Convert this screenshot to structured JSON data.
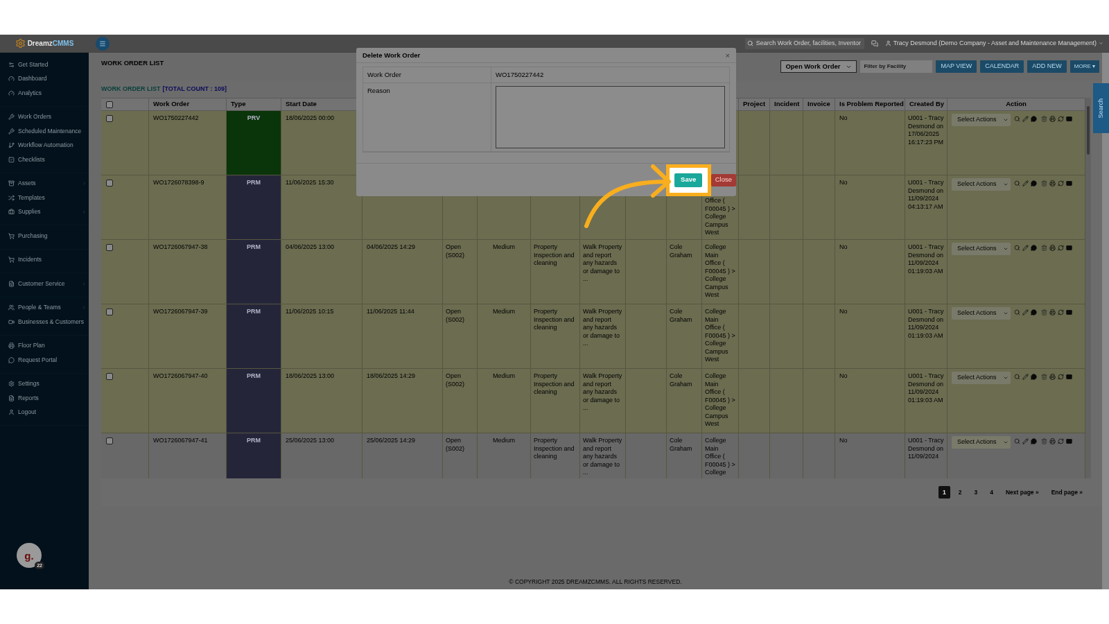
{
  "logo": {
    "name": "Dreamz",
    "suffix": "CMMS"
  },
  "top_bar": {
    "search": {
      "placeholder": "Search Work Order, facilities, Inventor"
    },
    "user": "Tracy Desmond (Demo Company - Asset and Maintenance Management)"
  },
  "sidebar": {
    "groups": [
      [
        {
          "label": "Get Started",
          "has_submenu": false
        },
        {
          "label": "Dashboard",
          "has_submenu": false
        },
        {
          "label": "Analytics",
          "has_submenu": false
        }
      ],
      [
        {
          "label": "Work Orders",
          "has_submenu": false
        },
        {
          "label": "Scheduled Maintenance",
          "has_submenu": false
        },
        {
          "label": "Workflow Automation",
          "has_submenu": false
        },
        {
          "label": "Checklists",
          "has_submenu": false
        }
      ],
      [
        {
          "label": "Assets",
          "has_submenu": true
        },
        {
          "label": "Templates",
          "has_submenu": false
        },
        {
          "label": "Supplies",
          "has_submenu": true
        }
      ],
      [
        {
          "label": "Purchasing",
          "has_submenu": false
        }
      ],
      [
        {
          "label": "Incidents",
          "has_submenu": false
        }
      ],
      [
        {
          "label": "Customer Service",
          "has_submenu": true
        }
      ],
      [
        {
          "label": "People & Teams",
          "has_submenu": true
        },
        {
          "label": "Businesses & Customers",
          "has_submenu": false
        }
      ],
      [
        {
          "label": "Floor Plan",
          "has_submenu": false
        },
        {
          "label": "Request Portal",
          "has_submenu": false
        }
      ],
      [
        {
          "label": "Settings",
          "has_submenu": false
        },
        {
          "label": "Reports",
          "has_submenu": false
        },
        {
          "label": "Logout",
          "has_submenu": false
        }
      ]
    ],
    "avatar": {
      "letter": "g.",
      "badge": "22"
    }
  },
  "page_title": "WORK ORDER LIST",
  "toolbar": {
    "status_select": "Open Work Order",
    "facility_filter": {
      "placeholder": "Filter by Facility"
    },
    "buttons": [
      "MAP VIEW",
      "CALENDAR",
      "ADD NEW"
    ],
    "more": "MORE ▾"
  },
  "side_tab": "Search",
  "list": {
    "title": "WORK ORDER LIST",
    "count": "[TOTAL COUNT : 109]",
    "select_all": {
      "checked": false
    },
    "headers": {
      "work_order": "Work Order",
      "type": "Type",
      "start_date": "Start Date",
      "project": "Project",
      "incident": "Incident",
      "invoice": "Invoice",
      "is_problem_reported": "Is Problem Reported",
      "created_by": "Created By",
      "action": "Action"
    },
    "rows": [
      {
        "selected": false,
        "highlighted": true,
        "work_order": "WO1750227442",
        "type": {
          "label": "PRV",
          "color": "#0a340a"
        },
        "start_date": "18/06/2025 00:00",
        "is_problem_reported": "No",
        "created_by": "U001 - Tracy Desmond on 17/06/2025 16:17:23 PM",
        "action_select": "Select Actions"
      },
      {
        "selected": false,
        "highlighted": true,
        "location_cut_top": true,
        "work_order": "WO1726078398-9",
        "type": {
          "label": "PRM",
          "color": "#25253a"
        },
        "start_date": "11/06/2025 15:30",
        "column_12": "Office ( F00045 ) > College Campus West",
        "is_problem_reported": "No",
        "created_by": "U001 - Tracy Desmond on 11/09/2024 04:13:17 AM",
        "action_select": "Select Actions"
      },
      {
        "selected": false,
        "highlighted": true,
        "work_order": "WO1726067947-38",
        "type": {
          "label": "PRM",
          "color": "#25253a"
        },
        "start_date": "04/06/2025 13:00",
        "column_5": "04/06/2025 14:29",
        "column_6": "Open (S002)",
        "column_7": "Medium",
        "column_8": "Property Inspection and cleaning",
        "column_9": "Walk Property and report any hazards or damage to ...",
        "column_11": "Cole Graham",
        "column_12": "College Main Office ( F00045 ) > College Campus West",
        "is_problem_reported": "No",
        "created_by": "U001 - Tracy Desmond on 11/09/2024 01:19:03 AM",
        "action_select": "Select Actions"
      },
      {
        "selected": false,
        "highlighted": true,
        "work_order": "WO1726067947-39",
        "type": {
          "label": "PRM",
          "color": "#25253a"
        },
        "start_date": "11/06/2025 10:15",
        "column_5": "11/06/2025 11:44",
        "column_6": "Open (S002)",
        "column_7": "Medium",
        "column_8": "Property Inspection and cleaning",
        "column_9": "Walk Property and report any hazards or damage to ...",
        "column_11": "Cole Graham",
        "column_12": "College Main Office ( F00045 ) > College Campus West",
        "is_problem_reported": "No",
        "created_by": "U001 - Tracy Desmond on 11/09/2024 01:19:03 AM",
        "action_select": "Select Actions"
      },
      {
        "selected": false,
        "highlighted": true,
        "work_order": "WO1726067947-40",
        "type": {
          "label": "PRM",
          "color": "#25253a"
        },
        "start_date": "18/06/2025 13:00",
        "column_5": "18/06/2025 14:29",
        "column_6": "Open (S002)",
        "column_7": "Medium",
        "column_8": "Property Inspection and cleaning",
        "column_9": "Walk Property and report any hazards or damage to ...",
        "column_11": "Cole Graham",
        "column_12": "College Main Office ( F00045 ) > College Campus West",
        "is_problem_reported": "No",
        "created_by": "U001 - Tracy Desmond on 11/09/2024 01:19:03 AM",
        "action_select": "Select Actions"
      },
      {
        "selected": false,
        "highlighted": false,
        "work_order": "WO1726067947-41",
        "type": {
          "label": "PRM",
          "color": "#25253a"
        },
        "start_date": "25/06/2025 13:00",
        "column_5": "25/06/2025 14:29",
        "column_6": "Open (S002)",
        "column_7": "Medium",
        "column_8": "Property Inspection and cleaning",
        "column_9": "Walk Property and report any hazards or damage to ...",
        "column_11": "Cole Graham",
        "column_12": "College Main Office ( F00045 ) > College",
        "is_problem_reported": "No",
        "created_by": "U001 - Tracy Desmond on 11/09/2024",
        "action_select": "Select Actions"
      }
    ]
  },
  "pagination": [
    {
      "label": "1",
      "selected": true
    },
    {
      "label": "2",
      "selected": false
    },
    {
      "label": "3",
      "selected": false
    },
    {
      "label": "4",
      "selected": false
    },
    {
      "label": "Next page »",
      "selected": false
    },
    {
      "label": "End page »",
      "selected": false
    }
  ],
  "footer": "© COPYRIGHT 2025 DREAMZCMMS. ALL RIGHTS RESERVED.",
  "modal": {
    "title": "Delete Work Order",
    "close_glyph": "×",
    "fields": [
      {
        "label": "Work Order",
        "kind": "text",
        "value": "WO1750227442"
      },
      {
        "label": "Reason",
        "kind": "textarea"
      }
    ],
    "save": "Save",
    "close": "Close"
  }
}
